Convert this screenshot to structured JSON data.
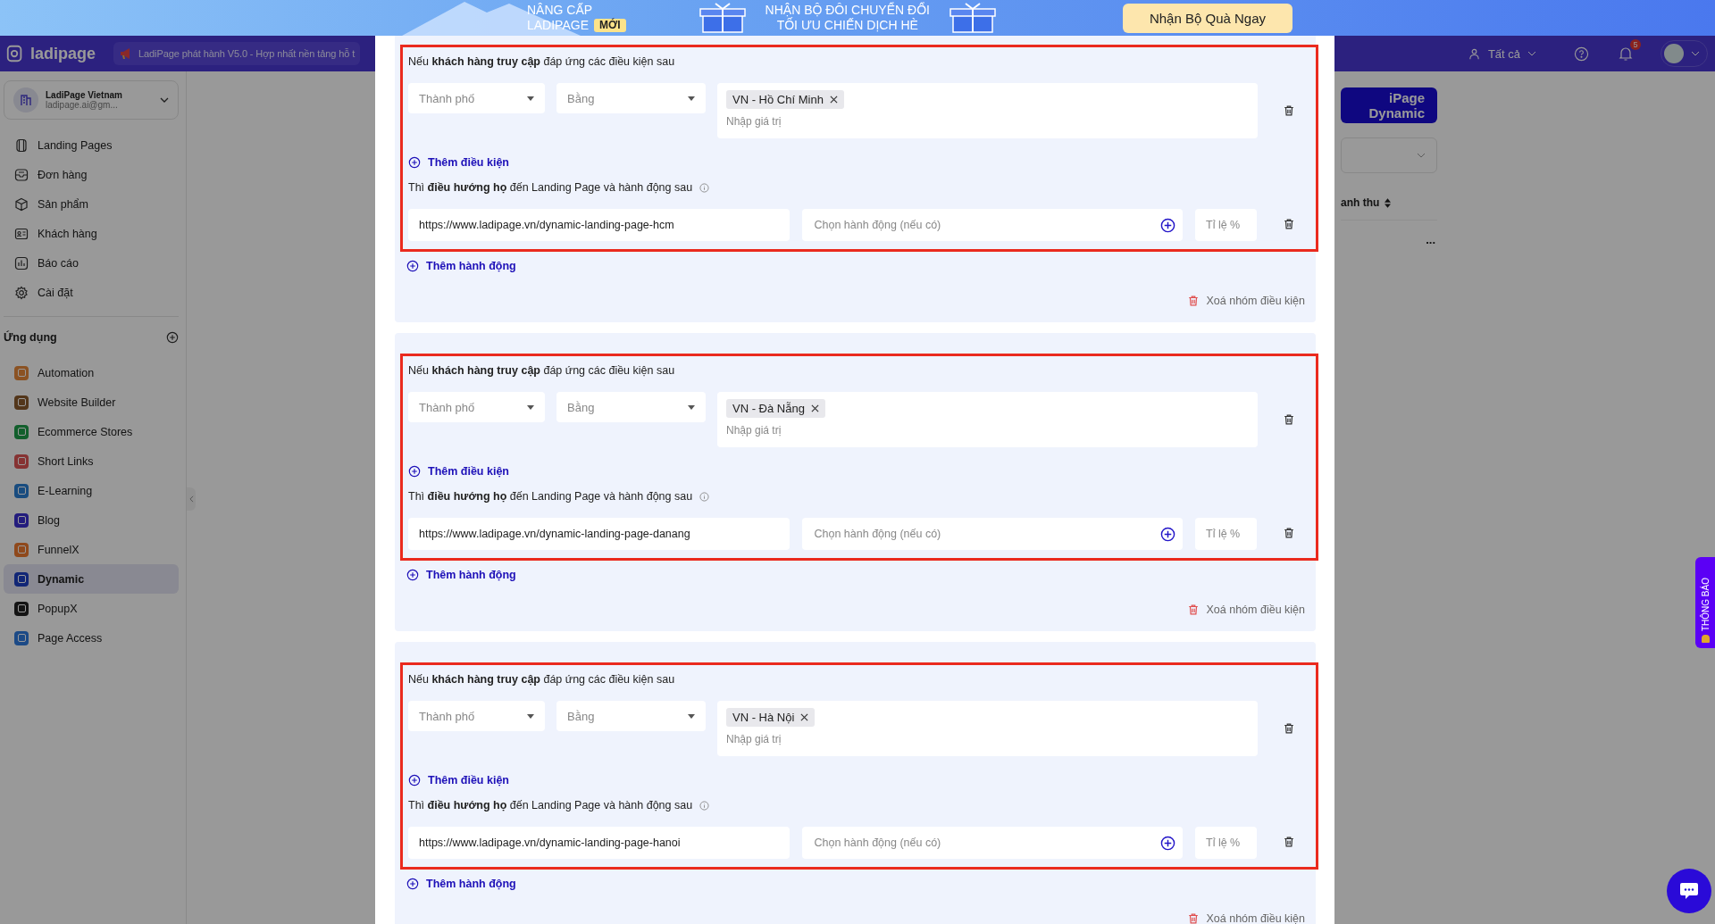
{
  "promo_banner": {
    "upgrade_line": "NÂNG CẤP",
    "brand_line": "LADIPAGE",
    "badge": "MỚI",
    "offer_line_1": "NHẬN BỘ ĐÔI CHUYỂN ĐỔI",
    "offer_line_2": "TỐI ƯU CHIẾN DỊCH HÈ",
    "button": "Nhận Bộ Quà Ngay"
  },
  "header": {
    "logo": "ladipage",
    "announcement": "LadiPage phát hành V5.0 - Hợp nhất nền tảng hỗ t",
    "filter": "Tất cả",
    "notification_count": "5"
  },
  "sidebar": {
    "account": {
      "name": "LadiPage Vietnam",
      "email": "ladipage.ai@gm..."
    },
    "items": [
      {
        "label": "Landing Pages"
      },
      {
        "label": "Đơn hàng"
      },
      {
        "label": "Sản phẩm"
      },
      {
        "label": "Khách hàng"
      },
      {
        "label": "Báo cáo"
      },
      {
        "label": "Cài đặt"
      }
    ],
    "section_title": "Ứng dụng",
    "apps": [
      {
        "label": "Automation",
        "color": "#8b5223",
        "selected": false
      },
      {
        "label": "Website Builder",
        "color": "#53361a",
        "selected": false
      },
      {
        "label": "Ecommerce Stores",
        "color": "#125f2c",
        "selected": false
      },
      {
        "label": "Short Links",
        "color": "#863333",
        "selected": false
      },
      {
        "label": "E-Learning",
        "color": "#194c7f",
        "selected": false
      },
      {
        "label": "Blog",
        "color": "#231c7d",
        "selected": false
      },
      {
        "label": "FunnelX",
        "color": "#8f491c",
        "selected": false
      },
      {
        "label": "Dynamic",
        "color": "#112676",
        "selected": true
      },
      {
        "label": "PopupX",
        "color": "#141414",
        "selected": false
      },
      {
        "label": "Page Access",
        "color": "#1c4a86",
        "selected": false
      }
    ]
  },
  "background_page": {
    "create_button": "iPage Dynamic",
    "column_header": "anh thu",
    "more": "..."
  },
  "condition_groups": [
    {
      "highlighted": true,
      "condition_intro": "Nếu **khách hàng truy cập** đáp ứng các điều kiện sau",
      "field": "Thành phố",
      "operator": "Bằng",
      "tags": [
        "VN - Hồ Chí Minh"
      ],
      "value_placeholder": "Nhập giá trị",
      "add_condition": "Thêm điều kiện",
      "redirect_intro": "Thì **điều hướng họ** đến Landing Page và hành động sau",
      "url": "https://www.ladipage.vn/dynamic-landing-page-hcm",
      "action_placeholder": "Chọn hành động (nếu có)",
      "ratio_placeholder": "Tỉ lệ %",
      "add_action": "Thêm hành động",
      "delete_group": "Xoá nhóm điều kiện"
    },
    {
      "highlighted": true,
      "condition_intro": "Nếu **khách hàng truy cập** đáp ứng các điều kiện sau",
      "field": "Thành phố",
      "operator": "Bằng",
      "tags": [
        "VN - Đà Nẵng"
      ],
      "value_placeholder": "Nhập giá trị",
      "add_condition": "Thêm điều kiện",
      "redirect_intro": "Thì **điều hướng họ** đến Landing Page và hành động sau",
      "url": "https://www.ladipage.vn/dynamic-landing-page-danang",
      "action_placeholder": "Chọn hành động (nếu có)",
      "ratio_placeholder": "Tỉ lệ %",
      "add_action": "Thêm hành động",
      "delete_group": "Xoá nhóm điều kiện"
    },
    {
      "highlighted": true,
      "condition_intro": "Nếu **khách hàng truy cập** đáp ứng các điều kiện sau",
      "field": "Thành phố",
      "operator": "Bằng",
      "tags": [
        "VN - Hà Nội"
      ],
      "value_placeholder": "Nhập giá trị",
      "add_condition": "Thêm điều kiện",
      "redirect_intro": "Thì **điều hướng họ** đến Landing Page và hành động sau",
      "url": "https://www.ladipage.vn/dynamic-landing-page-hanoi",
      "action_placeholder": "Chọn hành động (nếu có)",
      "ratio_placeholder": "Tỉ lệ %",
      "add_action": "Thêm hành động",
      "delete_group": "Xoá nhóm điều kiện"
    }
  ],
  "notification_tab": "THÔNG BÁO"
}
